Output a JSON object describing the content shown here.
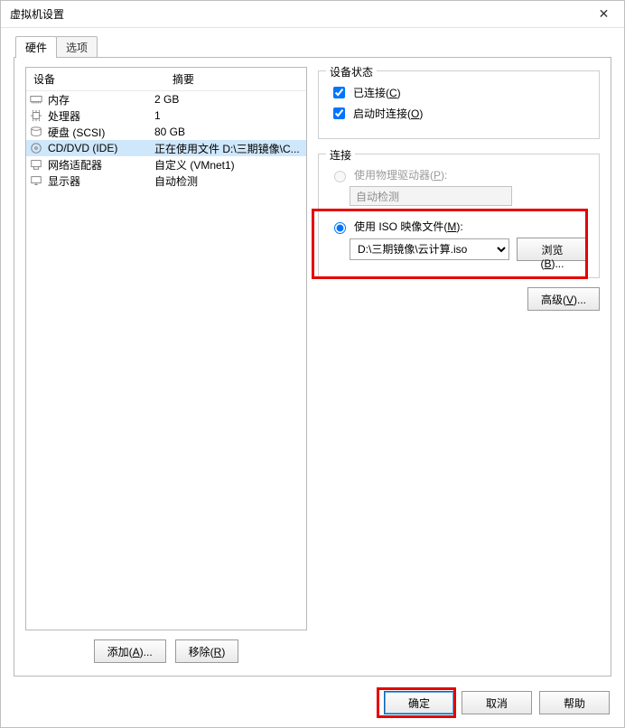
{
  "window": {
    "title": "虚拟机设置",
    "close_glyph": "✕"
  },
  "tabs": {
    "items": [
      {
        "label": "硬件",
        "active": true
      },
      {
        "label": "选项",
        "active": false
      }
    ]
  },
  "hardware": {
    "column_device": "设备",
    "column_summary": "摘要",
    "rows": [
      {
        "icon": "memory",
        "name": "内存",
        "summary": "2 GB",
        "selected": false
      },
      {
        "icon": "cpu",
        "name": "处理器",
        "summary": "1",
        "selected": false
      },
      {
        "icon": "hdd",
        "name": "硬盘 (SCSI)",
        "summary": "80 GB",
        "selected": false
      },
      {
        "icon": "cd",
        "name": "CD/DVD (IDE)",
        "summary": "正在使用文件 D:\\三期镜像\\C...",
        "selected": true
      },
      {
        "icon": "nic",
        "name": "网络适配器",
        "summary": "自定义 (VMnet1)",
        "selected": false
      },
      {
        "icon": "display",
        "name": "显示器",
        "summary": "自动检测",
        "selected": false
      }
    ],
    "add_button": "添加(A)...",
    "remove_button": "移除(R)"
  },
  "status_group": {
    "legend": "设备状态",
    "connected_label": "已连接(C)",
    "connected_checked": true,
    "connect_at_poweron_label": "启动时连接(O)",
    "connect_at_poweron_checked": true
  },
  "connection_group": {
    "legend": "连接",
    "physical_label": "使用物理驱动器(P):",
    "physical_selected": false,
    "physical_dropdown": "自动检测",
    "iso_label": "使用 ISO 映像文件(M):",
    "iso_selected": true,
    "iso_path": "D:\\三期镜像\\云计算.iso",
    "browse_button": "浏览(B)..."
  },
  "advanced_button": "高级(V)...",
  "dialog_buttons": {
    "ok": "确定",
    "cancel": "取消",
    "help": "帮助"
  }
}
